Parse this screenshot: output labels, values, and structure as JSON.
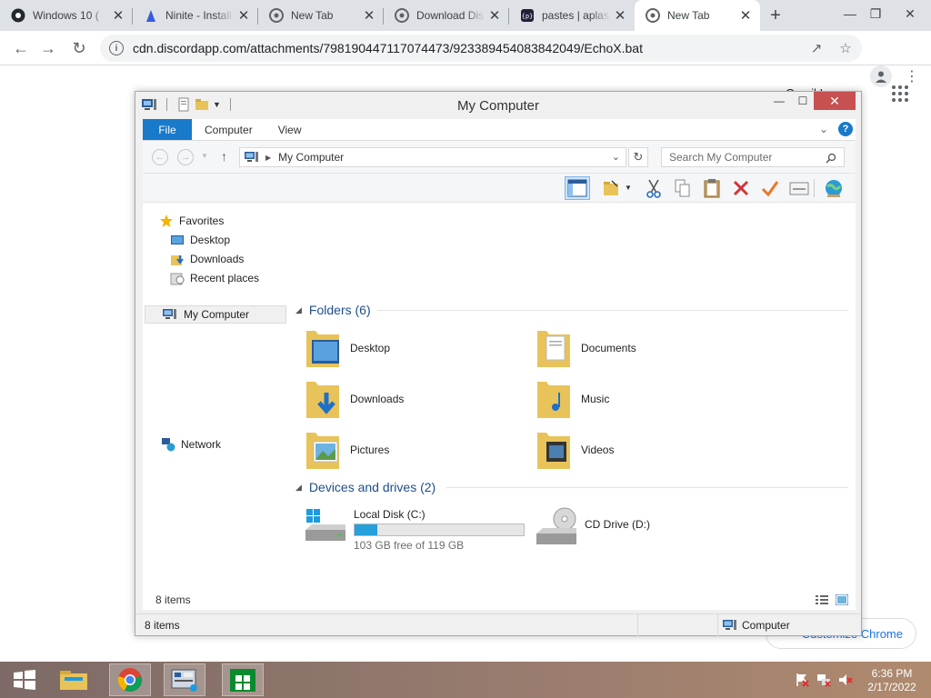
{
  "browser": {
    "tabs": [
      {
        "title": "Windows 10 (",
        "favicon": "github-icon"
      },
      {
        "title": "Ninite - Install",
        "favicon": "ninite-icon"
      },
      {
        "title": "New Tab",
        "favicon": "chrome-icon"
      },
      {
        "title": "Download Dis",
        "favicon": "chrome-icon"
      },
      {
        "title": "pastes | aplas",
        "favicon": "pastes-icon"
      },
      {
        "title": "New Tab",
        "favicon": "chrome-icon",
        "active": true
      }
    ],
    "new_tab_label": "+",
    "url": "cdn.discordapp.com/attachments/798190447117074473/923389454083842049/EchoX.bat"
  },
  "page": {
    "gmail_partial": "Gmail   Images",
    "customize_label": "Customize Chrome"
  },
  "explorer": {
    "window_title": "My Computer",
    "ribbon_tabs": [
      "File",
      "Computer",
      "View"
    ],
    "address": "My Computer",
    "search_placeholder": "Search My Computer",
    "nav": {
      "favorites": "Favorites",
      "desktop": "Desktop",
      "downloads": "Downloads",
      "recent": "Recent places",
      "computer": "My Computer",
      "network": "Network"
    },
    "folders_header": "Folders (6)",
    "folders": [
      "Desktop",
      "Documents",
      "Downloads",
      "Music",
      "Pictures",
      "Videos"
    ],
    "devices_header": "Devices and drives (2)",
    "drives": [
      {
        "name": "Local Disk (C:)",
        "free": "103 GB free of 119 GB",
        "used_fraction": 0.134
      },
      {
        "name": "CD Drive (D:)"
      }
    ],
    "status_items": "8 items",
    "status_bar_items": "8 items",
    "status_bar_location": "Computer"
  },
  "taskbar": {
    "time": "6:36 PM",
    "date": "2/17/2022"
  },
  "colors": {
    "ribbon_file": "#1979ca",
    "drive_fill": "#26a0da",
    "close_button": "#c75050",
    "link_blue": "#1e4e8c"
  }
}
